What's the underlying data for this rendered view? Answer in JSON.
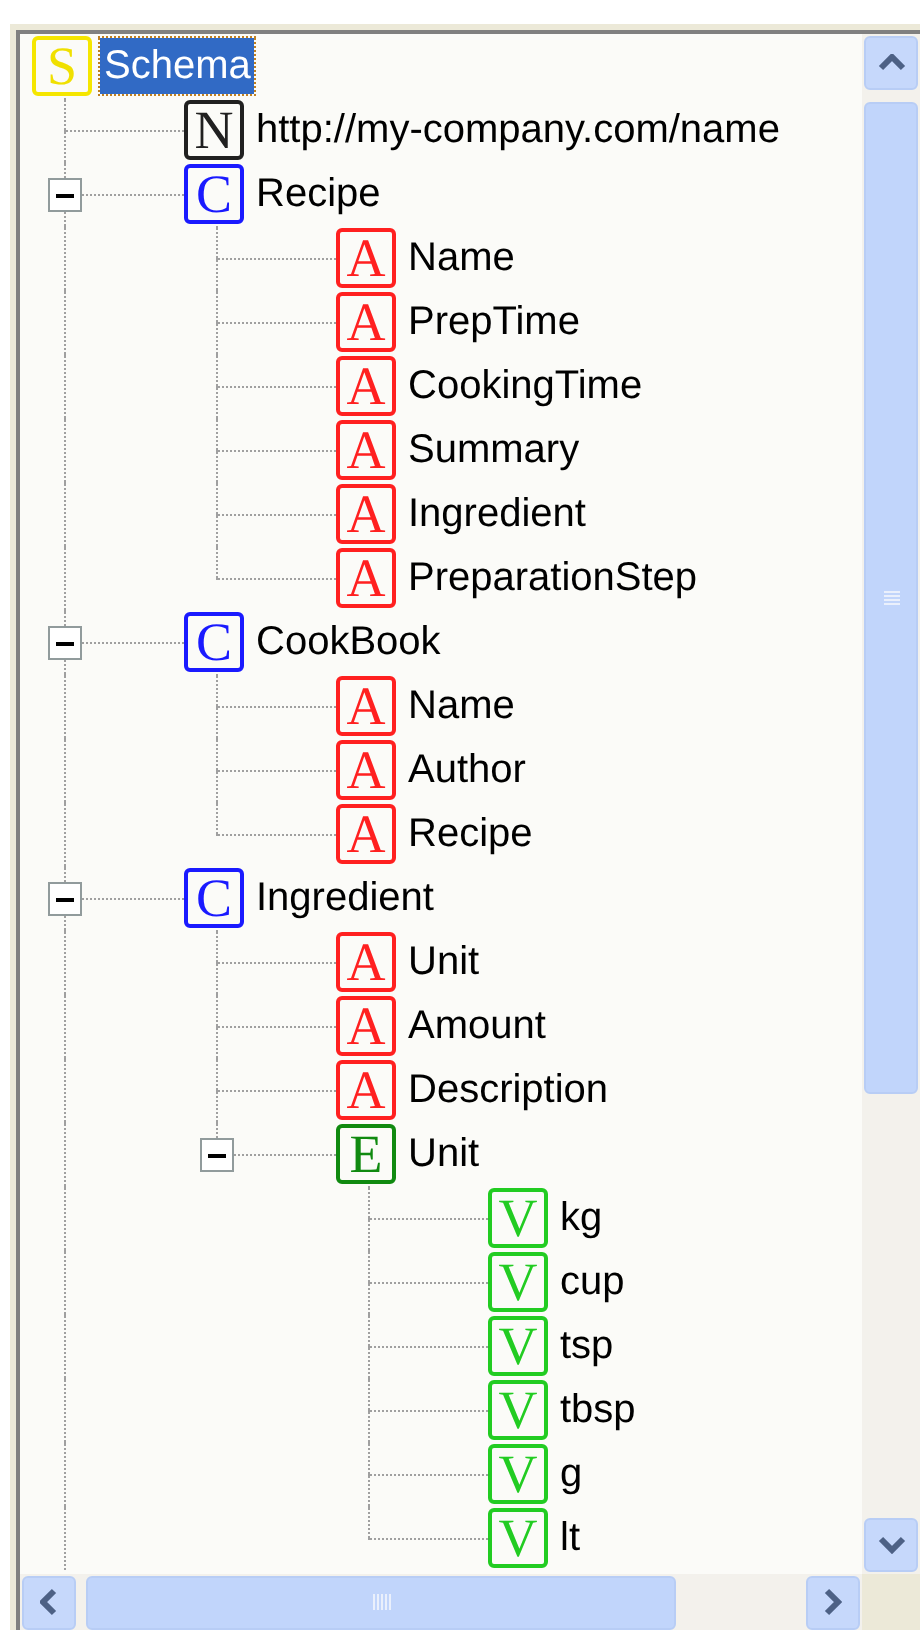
{
  "tree": [
    {
      "badge": "S",
      "kind": "schema",
      "label": "Schema",
      "selected": true,
      "children": [
        {
          "badge": "N",
          "kind": "namespace",
          "label": "http://my-company.com/name",
          "selected": false
        },
        {
          "badge": "C",
          "kind": "class",
          "label": "Recipe",
          "selected": false,
          "expanded": true,
          "children": [
            {
              "badge": "A",
              "kind": "attribute",
              "label": "Name",
              "selected": false
            },
            {
              "badge": "A",
              "kind": "attribute",
              "label": "PrepTime",
              "selected": false
            },
            {
              "badge": "A",
              "kind": "attribute",
              "label": "CookingTime",
              "selected": false
            },
            {
              "badge": "A",
              "kind": "attribute",
              "label": "Summary",
              "selected": false
            },
            {
              "badge": "A",
              "kind": "attribute",
              "label": "Ingredient",
              "selected": false
            },
            {
              "badge": "A",
              "kind": "attribute",
              "label": "PreparationStep",
              "selected": false
            }
          ]
        },
        {
          "badge": "C",
          "kind": "class",
          "label": "CookBook",
          "selected": false,
          "expanded": true,
          "children": [
            {
              "badge": "A",
              "kind": "attribute",
              "label": "Name",
              "selected": false
            },
            {
              "badge": "A",
              "kind": "attribute",
              "label": "Author",
              "selected": false
            },
            {
              "badge": "A",
              "kind": "attribute",
              "label": "Recipe",
              "selected": false
            }
          ]
        },
        {
          "badge": "C",
          "kind": "class",
          "label": "Ingredient",
          "selected": false,
          "expanded": true,
          "children": [
            {
              "badge": "A",
              "kind": "attribute",
              "label": "Unit",
              "selected": false
            },
            {
              "badge": "A",
              "kind": "attribute",
              "label": "Amount",
              "selected": false
            },
            {
              "badge": "A",
              "kind": "attribute",
              "label": "Description",
              "selected": false
            },
            {
              "badge": "E",
              "kind": "enumeration",
              "label": "Unit",
              "selected": false,
              "expanded": true,
              "children": [
                {
                  "badge": "V",
                  "kind": "value",
                  "label": "kg",
                  "selected": false
                },
                {
                  "badge": "V",
                  "kind": "value",
                  "label": "cup",
                  "selected": false
                },
                {
                  "badge": "V",
                  "kind": "value",
                  "label": "tsp",
                  "selected": false
                },
                {
                  "badge": "V",
                  "kind": "value",
                  "label": "tbsp",
                  "selected": false
                },
                {
                  "badge": "V",
                  "kind": "value",
                  "label": "g",
                  "selected": false
                },
                {
                  "badge": "V",
                  "kind": "value",
                  "label": "lt",
                  "selected": false
                }
              ]
            }
          ]
        }
      ]
    }
  ]
}
